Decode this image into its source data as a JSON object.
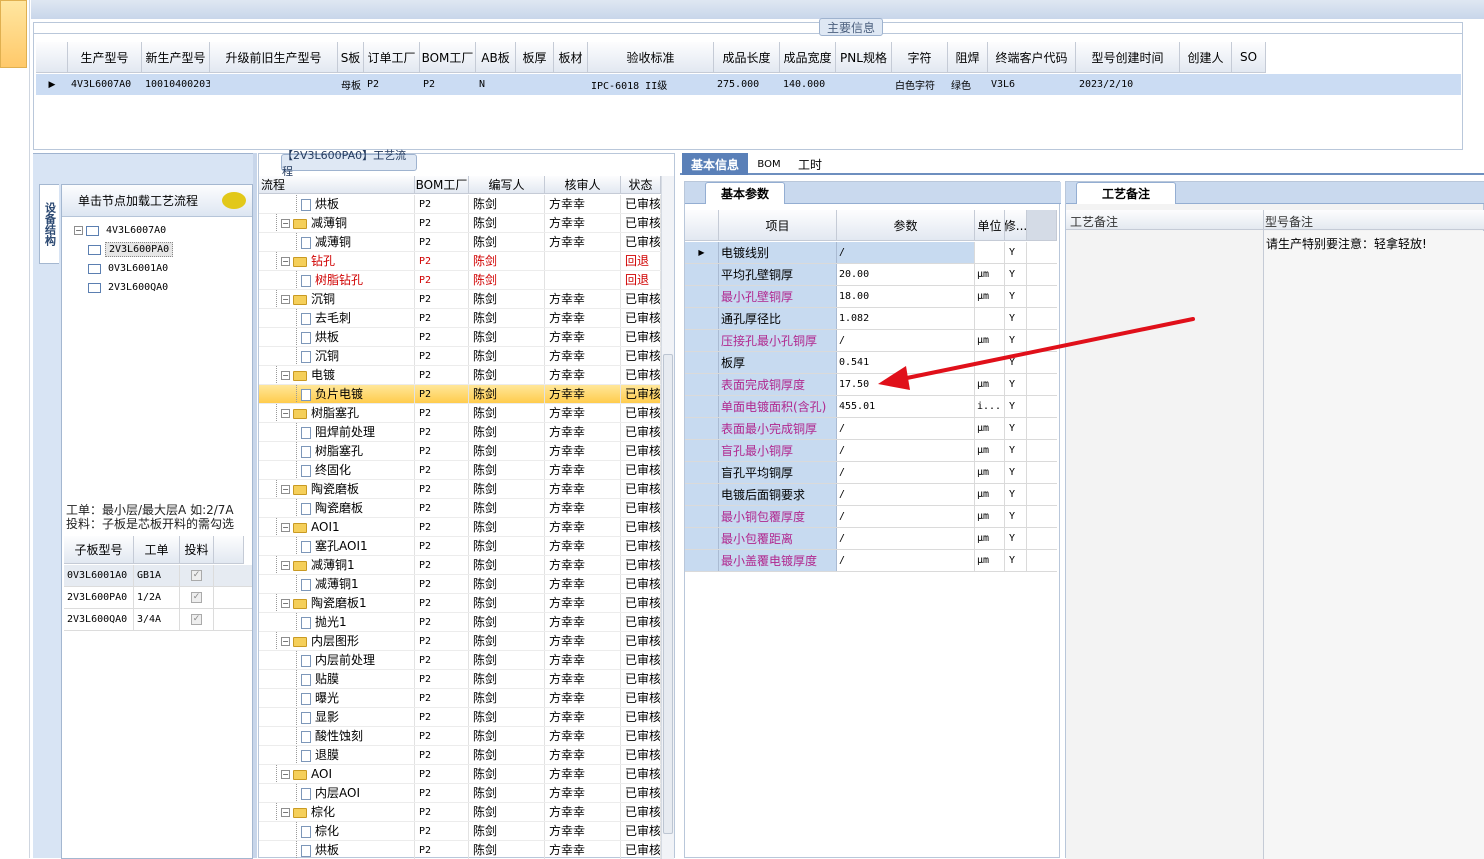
{
  "main_info": {
    "caption": "主要信息",
    "columns": [
      "生产型号",
      "新生产型号",
      "升级前旧生产型号",
      "S板",
      "订单工厂",
      "BOM工厂",
      "AB板",
      "板厚",
      "板材",
      "验收标准",
      "成品长度",
      "成品宽度",
      "PNL规格",
      "字符",
      "阻焊",
      "终端客户代码",
      "型号创建时间",
      "创建人",
      "SO"
    ],
    "row": [
      "4V3L6007A0",
      "10010400203700",
      "",
      "母板",
      "P2",
      "P2",
      "N",
      "",
      "",
      "IPC-6018 II级",
      "275.000",
      "140.000",
      "",
      "白色字符",
      "绿色",
      "V3L6",
      "2023/2/10",
      "",
      ""
    ]
  },
  "left_panel": {
    "vertical_tab": "设备结构",
    "header": "单击节点加载工艺流程",
    "tree": [
      "4V3L6007A0",
      "2V3L600PA0",
      "0V3L6001A0",
      "2V3L600QA0"
    ],
    "note_line1": "工单：最小层/最大层A 如:2/7A",
    "note_line2": "投料：子板是芯板开料的需勾选",
    "sub_table": {
      "columns": [
        "子板型号",
        "工单",
        "投料"
      ],
      "rows": [
        [
          "0V3L6001A0",
          "GB1A"
        ],
        [
          "2V3L600PA0",
          "1/2A"
        ],
        [
          "2V3L600QA0",
          "3/4A"
        ]
      ]
    }
  },
  "process": {
    "caption": "【2V3L600PA0】工艺流程",
    "columns": [
      "流程",
      "BOM工厂",
      "编写人",
      "核审人",
      "状态"
    ],
    "rows": [
      {
        "name": "烘板",
        "level": 2,
        "folder": false,
        "bom": "P2",
        "writer": "陈剑",
        "checker": "方幸幸",
        "status": "已审核",
        "red": false
      },
      {
        "name": "减薄铜",
        "level": 1,
        "folder": true,
        "bom": "P2",
        "writer": "陈剑",
        "checker": "方幸幸",
        "status": "已审核",
        "red": false
      },
      {
        "name": "减薄铜",
        "level": 2,
        "folder": false,
        "bom": "P2",
        "writer": "陈剑",
        "checker": "方幸幸",
        "status": "已审核",
        "red": false
      },
      {
        "name": "钻孔",
        "level": 1,
        "folder": true,
        "bom": "P2",
        "writer": "陈剑",
        "checker": "",
        "status": "回退",
        "red": true
      },
      {
        "name": "树脂钻孔",
        "level": 2,
        "folder": false,
        "bom": "P2",
        "writer": "陈剑",
        "checker": "",
        "status": "回退",
        "red": true
      },
      {
        "name": "沉铜",
        "level": 1,
        "folder": true,
        "bom": "P2",
        "writer": "陈剑",
        "checker": "方幸幸",
        "status": "已审核",
        "red": false
      },
      {
        "name": "去毛刺",
        "level": 2,
        "folder": false,
        "bom": "P2",
        "writer": "陈剑",
        "checker": "方幸幸",
        "status": "已审核",
        "red": false
      },
      {
        "name": "烘板",
        "level": 2,
        "folder": false,
        "bom": "P2",
        "writer": "陈剑",
        "checker": "方幸幸",
        "status": "已审核",
        "red": false
      },
      {
        "name": "沉铜",
        "level": 2,
        "folder": false,
        "bom": "P2",
        "writer": "陈剑",
        "checker": "方幸幸",
        "status": "已审核",
        "red": false
      },
      {
        "name": "电镀",
        "level": 1,
        "folder": true,
        "bom": "P2",
        "writer": "陈剑",
        "checker": "方幸幸",
        "status": "已审核",
        "red": false
      },
      {
        "name": "负片电镀",
        "level": 2,
        "folder": false,
        "bom": "P2",
        "writer": "陈剑",
        "checker": "方幸幸",
        "status": "已审核",
        "red": false,
        "selected": true
      },
      {
        "name": "树脂塞孔",
        "level": 1,
        "folder": true,
        "bom": "P2",
        "writer": "陈剑",
        "checker": "方幸幸",
        "status": "已审核",
        "red": false
      },
      {
        "name": "阻焊前处理",
        "level": 2,
        "folder": false,
        "bom": "P2",
        "writer": "陈剑",
        "checker": "方幸幸",
        "status": "已审核",
        "red": false
      },
      {
        "name": "树脂塞孔",
        "level": 2,
        "folder": false,
        "bom": "P2",
        "writer": "陈剑",
        "checker": "方幸幸",
        "status": "已审核",
        "red": false
      },
      {
        "name": "终固化",
        "level": 2,
        "folder": false,
        "bom": "P2",
        "writer": "陈剑",
        "checker": "方幸幸",
        "status": "已审核",
        "red": false
      },
      {
        "name": "陶瓷磨板",
        "level": 1,
        "folder": true,
        "bom": "P2",
        "writer": "陈剑",
        "checker": "方幸幸",
        "status": "已审核",
        "red": false
      },
      {
        "name": "陶瓷磨板",
        "level": 2,
        "folder": false,
        "bom": "P2",
        "writer": "陈剑",
        "checker": "方幸幸",
        "status": "已审核",
        "red": false
      },
      {
        "name": "AOI1",
        "level": 1,
        "folder": true,
        "bom": "P2",
        "writer": "陈剑",
        "checker": "方幸幸",
        "status": "已审核",
        "red": false
      },
      {
        "name": "塞孔AOI1",
        "level": 2,
        "folder": false,
        "bom": "P2",
        "writer": "陈剑",
        "checker": "方幸幸",
        "status": "已审核",
        "red": false
      },
      {
        "name": "减薄铜1",
        "level": 1,
        "folder": true,
        "bom": "P2",
        "writer": "陈剑",
        "checker": "方幸幸",
        "status": "已审核",
        "red": false
      },
      {
        "name": "减薄铜1",
        "level": 2,
        "folder": false,
        "bom": "P2",
        "writer": "陈剑",
        "checker": "方幸幸",
        "status": "已审核",
        "red": false
      },
      {
        "name": "陶瓷磨板1",
        "level": 1,
        "folder": true,
        "bom": "P2",
        "writer": "陈剑",
        "checker": "方幸幸",
        "status": "已审核",
        "red": false
      },
      {
        "name": "抛光1",
        "level": 2,
        "folder": false,
        "bom": "P2",
        "writer": "陈剑",
        "checker": "方幸幸",
        "status": "已审核",
        "red": false
      },
      {
        "name": "内层图形",
        "level": 1,
        "folder": true,
        "bom": "P2",
        "writer": "陈剑",
        "checker": "方幸幸",
        "status": "已审核",
        "red": false
      },
      {
        "name": "内层前处理",
        "level": 2,
        "folder": false,
        "bom": "P2",
        "writer": "陈剑",
        "checker": "方幸幸",
        "status": "已审核",
        "red": false
      },
      {
        "name": "贴膜",
        "level": 2,
        "folder": false,
        "bom": "P2",
        "writer": "陈剑",
        "checker": "方幸幸",
        "status": "已审核",
        "red": false
      },
      {
        "name": "曝光",
        "level": 2,
        "folder": false,
        "bom": "P2",
        "writer": "陈剑",
        "checker": "方幸幸",
        "status": "已审核",
        "red": false
      },
      {
        "name": "显影",
        "level": 2,
        "folder": false,
        "bom": "P2",
        "writer": "陈剑",
        "checker": "方幸幸",
        "status": "已审核",
        "red": false
      },
      {
        "name": "酸性蚀刻",
        "level": 2,
        "folder": false,
        "bom": "P2",
        "writer": "陈剑",
        "checker": "方幸幸",
        "status": "已审核",
        "red": false
      },
      {
        "name": "退膜",
        "level": 2,
        "folder": false,
        "bom": "P2",
        "writer": "陈剑",
        "checker": "方幸幸",
        "status": "已审核",
        "red": false
      },
      {
        "name": "AOI",
        "level": 1,
        "folder": true,
        "bom": "P2",
        "writer": "陈剑",
        "checker": "方幸幸",
        "status": "已审核",
        "red": false
      },
      {
        "name": "内层AOI",
        "level": 2,
        "folder": false,
        "bom": "P2",
        "writer": "陈剑",
        "checker": "方幸幸",
        "status": "已审核",
        "red": false
      },
      {
        "name": "棕化",
        "level": 1,
        "folder": true,
        "bom": "P2",
        "writer": "陈剑",
        "checker": "方幸幸",
        "status": "已审核",
        "red": false
      },
      {
        "name": "棕化",
        "level": 2,
        "folder": false,
        "bom": "P2",
        "writer": "陈剑",
        "checker": "方幸幸",
        "status": "已审核",
        "red": false
      },
      {
        "name": "烘板",
        "level": 2,
        "folder": false,
        "bom": "P2",
        "writer": "陈剑",
        "checker": "方幸幸",
        "status": "已审核",
        "red": false
      }
    ]
  },
  "right_tabs": [
    "基本信息",
    "BOM",
    "工时"
  ],
  "params": {
    "tab": "基本参数",
    "columns": [
      "项目",
      "参数",
      "单位",
      "修..."
    ],
    "rows": [
      {
        "item": "电镀线别",
        "value": "/",
        "unit": "",
        "mod": "Y",
        "magenta": false
      },
      {
        "item": "平均孔壁铜厚",
        "value": "20.00",
        "unit": "μm",
        "mod": "Y",
        "magenta": false
      },
      {
        "item": "最小孔壁铜厚",
        "value": "18.00",
        "unit": "μm",
        "mod": "Y",
        "magenta": true
      },
      {
        "item": "通孔厚径比",
        "value": "1.082",
        "unit": "",
        "mod": "Y",
        "magenta": false
      },
      {
        "item": "压接孔最小孔铜厚",
        "value": "/",
        "unit": "μm",
        "mod": "Y",
        "magenta": true
      },
      {
        "item": "板厚",
        "value": "0.541",
        "unit": "",
        "mod": "Y",
        "magenta": false
      },
      {
        "item": "表面完成铜厚度",
        "value": "17.50",
        "unit": "μm",
        "mod": "Y",
        "magenta": true
      },
      {
        "item": "单面电镀面积(含孔)",
        "value": "455.01",
        "unit": "i...",
        "mod": "Y",
        "magenta": true
      },
      {
        "item": "表面最小完成铜厚",
        "value": "/",
        "unit": "μm",
        "mod": "Y",
        "magenta": true
      },
      {
        "item": "盲孔最小铜厚",
        "value": "/",
        "unit": "μm",
        "mod": "Y",
        "magenta": true
      },
      {
        "item": "盲孔平均铜厚",
        "value": "/",
        "unit": "μm",
        "mod": "Y",
        "magenta": false
      },
      {
        "item": "电镀后面铜要求",
        "value": "/",
        "unit": "μm",
        "mod": "Y",
        "magenta": false
      },
      {
        "item": "最小铜包覆厚度",
        "value": "/",
        "unit": "μm",
        "mod": "Y",
        "magenta": true
      },
      {
        "item": "最小包覆距离",
        "value": "/",
        "unit": "μm",
        "mod": "Y",
        "magenta": true
      },
      {
        "item": "最小盖覆电镀厚度",
        "value": "/",
        "unit": "μm",
        "mod": "Y",
        "magenta": true
      }
    ]
  },
  "remarks": {
    "tab": "工艺备注",
    "col1": "工艺备注",
    "col2": "型号备注",
    "note": "请生产特别要注意：轻拿轻放!"
  },
  "colors": {
    "accent_blue": "#c7daf0",
    "selected_row": "#ffd35c",
    "arrow_red": "#e0101a",
    "magenta": "#b0278e"
  }
}
